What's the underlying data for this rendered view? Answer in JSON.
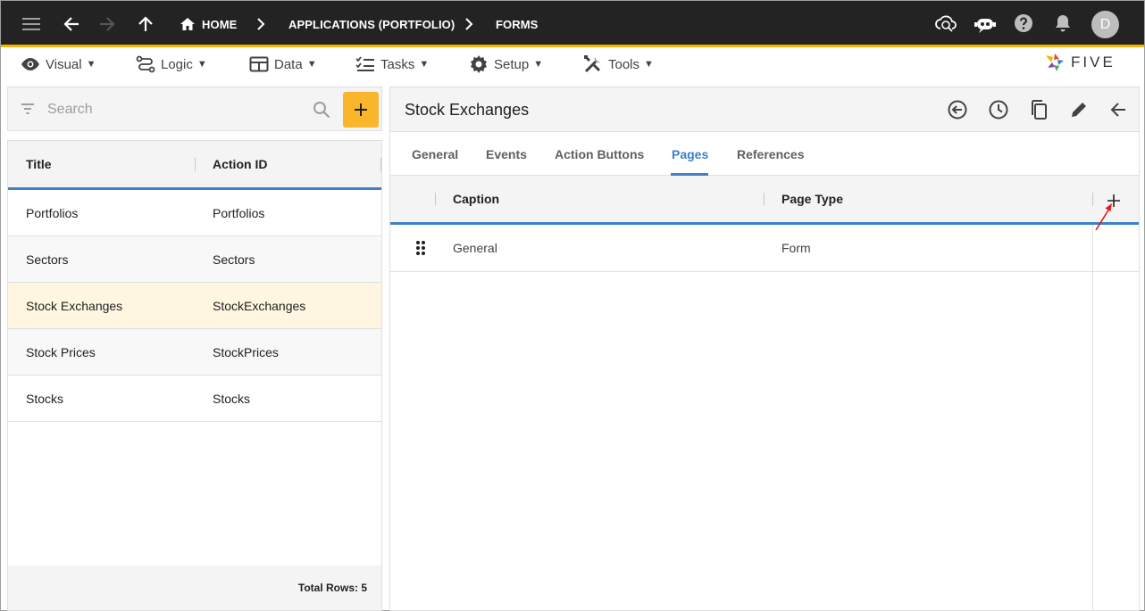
{
  "topbar": {
    "breadcrumbs": [
      "HOME",
      "APPLICATIONS (PORTFOLIO)",
      "FORMS"
    ],
    "avatar_letter": "D",
    "icons": [
      "menu-icon",
      "back-icon",
      "forward-icon",
      "up-icon",
      "home-icon",
      "cloud-sync-icon",
      "chat-bot-icon",
      "help-icon",
      "bell-icon"
    ]
  },
  "menu": {
    "items": [
      "Visual",
      "Logic",
      "Data",
      "Tasks",
      "Setup",
      "Tools"
    ],
    "caret": "▼",
    "logo_text": "FIVE"
  },
  "search": {
    "placeholder": "Search",
    "value": ""
  },
  "list": {
    "columns": [
      "Title",
      "Action ID"
    ],
    "rows": [
      {
        "title": "Portfolios",
        "action_id": "Portfolios"
      },
      {
        "title": "Sectors",
        "action_id": "Sectors"
      },
      {
        "title": "Stock Exchanges",
        "action_id": "StockExchanges"
      },
      {
        "title": "Stock Prices",
        "action_id": "StockPrices"
      },
      {
        "title": "Stocks",
        "action_id": "Stocks"
      }
    ],
    "selected_index": 2,
    "footer": "Total Rows: 5"
  },
  "detail": {
    "title": "Stock Exchanges",
    "tabs": [
      "General",
      "Events",
      "Action Buttons",
      "Pages",
      "References"
    ],
    "active_tab": "Pages",
    "grid": {
      "columns": [
        "Caption",
        "Page Type"
      ],
      "rows": [
        {
          "caption": "General",
          "page_type": "Form"
        }
      ]
    }
  },
  "colors": {
    "accent_yellow": "#f9b52c",
    "accent_blue": "#3f80c6",
    "topbar_bg": "#232323",
    "selected_row": "#fff6e2",
    "annotation_red": "#e31b1b"
  }
}
